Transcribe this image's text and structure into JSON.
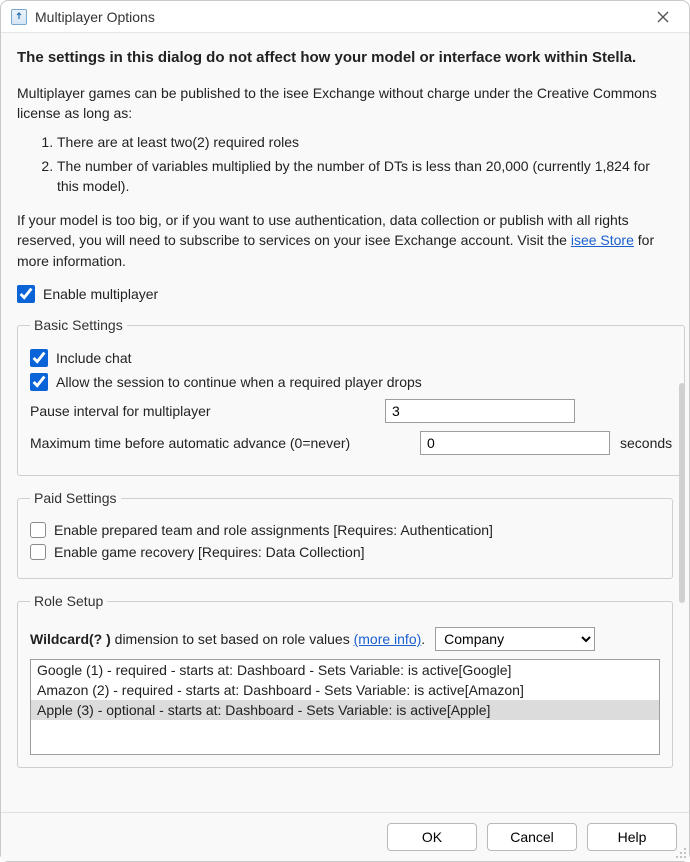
{
  "window": {
    "title": "Multiplayer Options"
  },
  "intro": {
    "headline": "The settings in this dialog do not affect how your model or interface work within Stella.",
    "paragraph1": "Multiplayer games can be published to the isee Exchange without charge under the Creative Commons license as long as:",
    "bullet1": "There are at least two(2) required roles",
    "bullet2": "The number of variables multiplied by the number of DTs is less than 20,000 (currently 1,824 for this model).",
    "paragraph2a": "If your model is too big, or if you want to use authentication, data collection or publish with all rights reserved, you will need to subscribe to services on your isee Exchange account. Visit the ",
    "link_text": "isee Store",
    "paragraph2b": " for more information."
  },
  "enable": {
    "label": "Enable multiplayer",
    "checked": true
  },
  "basic": {
    "legend": "Basic Settings",
    "include_chat_label": "Include chat",
    "include_chat_checked": true,
    "allow_continue_label": "Allow the session to continue when a required player drops",
    "allow_continue_checked": true,
    "pause_label": "Pause interval for multiplayer",
    "pause_value": "3",
    "max_time_label": "Maximum time before automatic advance (0=never)",
    "max_time_value": "0",
    "seconds_label": "seconds"
  },
  "paid": {
    "legend": "Paid Settings",
    "team_label": "Enable prepared team and role assignments [Requires: Authentication]",
    "team_checked": false,
    "recovery_label": "Enable game recovery [Requires: Data Collection]",
    "recovery_checked": false
  },
  "role": {
    "legend": "Role Setup",
    "wildcard_prefix": "Wildcard(? )",
    "wildcard_rest": " dimension to set based on role values ",
    "more_info": "(more info)",
    "dot": ".",
    "select_value": "Company",
    "items": [
      "Google (1) - required - starts at: Dashboard - Sets Variable: is active[Google]",
      "Amazon (2) - required - starts at: Dashboard - Sets Variable: is active[Amazon]",
      "Apple (3) - optional - starts at: Dashboard - Sets Variable: is active[Apple]"
    ],
    "selected_index": 2
  },
  "footer": {
    "ok": "OK",
    "cancel": "Cancel",
    "help": "Help"
  }
}
